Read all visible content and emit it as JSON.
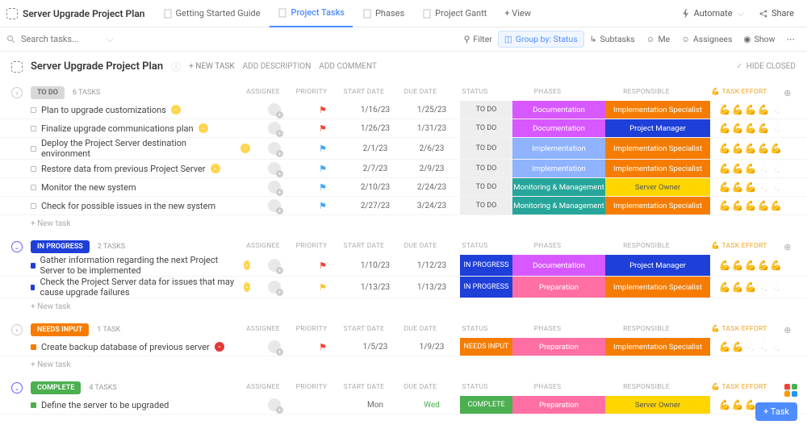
{
  "top": {
    "title": "Server Upgrade Project Plan",
    "tabs": [
      "Getting Started Guide",
      "Project Tasks",
      "Phases",
      "Project Gantt",
      "+ View"
    ],
    "active_tab": 1,
    "automate": "Automate",
    "share": "Share"
  },
  "toolbar": {
    "search_ph": "Search tasks...",
    "filter": "Filter",
    "group": "Group by: Status",
    "subtasks": "Subtasks",
    "me": "Me",
    "assignees": "Assignees",
    "show": "Show"
  },
  "header": {
    "title": "Server Upgrade Project Plan",
    "new_task": "+ NEW TASK",
    "add_desc": "ADD DESCRIPTION",
    "add_comm": "ADD COMMENT",
    "hide": "HIDE CLOSED"
  },
  "cols": {
    "as": "ASSIGNEE",
    "pr": "PRIORITY",
    "sd": "START DATE",
    "dd": "DUE DATE",
    "st": "STATUS",
    "ph": "PHASES",
    "rs": "RESPONSIBLE",
    "te": "TASK EFFORT"
  },
  "labels": {
    "new_task": "+ New task",
    "arm": "💪",
    "tasks": "TASKS",
    "task": "TASK"
  },
  "colors": {
    "todo": "#d8d8d8",
    "inprogress": "#1e3fd8",
    "needs": "#f57c00",
    "complete": "#4caf50",
    "flag_red": "#f44336",
    "flag_blue": "#42a5f5",
    "flag_yellow": "#fbc02d",
    "ph_doc": "#d858ff",
    "ph_imp": "#8fb3ff",
    "ph_mon": "#26a69a",
    "ph_prep": "#ff6fa3",
    "rs_is": "#f57c00",
    "rs_pm": "#1e3fd8",
    "rs_so": "#ffd600"
  },
  "sections": [
    {
      "name": "TO DO",
      "badge_bg": "#d8d8d8",
      "badge_fg": "#666",
      "count": 6,
      "caret_open": false,
      "tasks": [
        {
          "sq": "",
          "name": "Plan to upgrade customizations",
          "dot": "y",
          "flag": "flag_red",
          "sd": "1/16/23",
          "dd": "1/25/23",
          "st": "TO DO",
          "st_cls": "",
          "ph": "Documentation",
          "ph_cls": "ph-doc",
          "rs": "Implementation Specialist",
          "rs_cls": "rs-is",
          "eff": 4
        },
        {
          "sq": "",
          "name": "Finalize upgrade communications plan",
          "dot": "y",
          "flag": "flag_red",
          "sd": "1/26/23",
          "dd": "1/31/23",
          "st": "TO DO",
          "st_cls": "",
          "ph": "Documentation",
          "ph_cls": "ph-doc",
          "rs": "Project Manager",
          "rs_cls": "rs-pm",
          "eff": 4
        },
        {
          "sq": "",
          "name": "Deploy the Project Server destination environment",
          "dot": "y",
          "flag": "flag_blue",
          "sd": "2/1/23",
          "dd": "2/6/23",
          "st": "TO DO",
          "st_cls": "",
          "ph": "Implementation",
          "ph_cls": "ph-imp",
          "rs": "Implementation Specialist",
          "rs_cls": "rs-is",
          "eff": 5
        },
        {
          "sq": "",
          "name": "Restore data from previous Project Server",
          "dot": "y",
          "flag": "flag_blue",
          "sd": "2/7/23",
          "dd": "2/9/23",
          "st": "TO DO",
          "st_cls": "",
          "ph": "Implementation",
          "ph_cls": "ph-imp",
          "rs": "Implementation Specialist",
          "rs_cls": "rs-is",
          "eff": 3
        },
        {
          "sq": "",
          "name": "Monitor the new system",
          "dot": "",
          "flag": "flag_blue",
          "sd": "2/10/23",
          "dd": "2/24/23",
          "st": "TO DO",
          "st_cls": "",
          "ph": "Monitoring & Management",
          "ph_cls": "ph-mon",
          "rs": "Server Owner",
          "rs_cls": "rs-so",
          "eff": 3
        },
        {
          "sq": "",
          "name": "Check for possible issues in the new system",
          "dot": "",
          "flag": "flag_blue",
          "sd": "2/27/23",
          "dd": "3/24/23",
          "st": "TO DO",
          "st_cls": "",
          "ph": "Monitoring & Management",
          "ph_cls": "ph-mon",
          "rs": "Implementation Specialist",
          "rs_cls": "rs-is",
          "eff": 5
        }
      ]
    },
    {
      "name": "IN PROGRESS",
      "badge_bg": "#1e3fd8",
      "badge_fg": "#fff",
      "count": 2,
      "caret_open": true,
      "tasks": [
        {
          "sq": "blue",
          "name": "Gather information regarding the next Project Server to be implemented",
          "dot": "y",
          "flag": "flag_red",
          "sd": "1/10/23",
          "dd": "1/12/23",
          "st": "IN PROGRESS",
          "st_cls": "ip",
          "ph": "Documentation",
          "ph_cls": "ph-doc",
          "rs": "Project Manager",
          "rs_cls": "rs-pm",
          "eff": 5
        },
        {
          "sq": "blue",
          "name": "Check the Project Server data for issues that may cause upgrade failures",
          "dot": "y",
          "flag": "flag_yellow",
          "sd": "1/13/23",
          "dd": "1/13/23",
          "st": "IN PROGRESS",
          "st_cls": "ip",
          "ph": "Preparation",
          "ph_cls": "ph-prep",
          "rs": "Implementation Specialist",
          "rs_cls": "rs-is",
          "eff": 3
        }
      ]
    },
    {
      "name": "NEEDS INPUT",
      "badge_bg": "#f57c00",
      "badge_fg": "#fff",
      "count": 1,
      "caret_open": false,
      "tasks": [
        {
          "sq": "or",
          "name": "Create backup database of previous server",
          "dot": "r",
          "flag": "flag_red",
          "sd": "1/5/23",
          "dd": "1/9/23",
          "st": "NEEDS INPUT",
          "st_cls": "ni",
          "ph": "Preparation",
          "ph_cls": "ph-prep",
          "rs": "Implementation Specialist",
          "rs_cls": "rs-is",
          "eff": 2
        }
      ]
    },
    {
      "name": "COMPLETE",
      "badge_bg": "#4caf50",
      "badge_fg": "#fff",
      "count": 4,
      "caret_open": true,
      "tasks": [
        {
          "sq": "gr",
          "name": "Define the server to be upgraded",
          "dot": "",
          "flag": "",
          "sd": "Mon",
          "dd": "Wed",
          "dd_cls": "g",
          "st": "COMPLETE",
          "st_cls": "cp",
          "ph": "Preparation",
          "ph_cls": "ph-prep",
          "rs": "Server Owner",
          "rs_cls": "rs-so",
          "eff": 3
        }
      ]
    }
  ]
}
